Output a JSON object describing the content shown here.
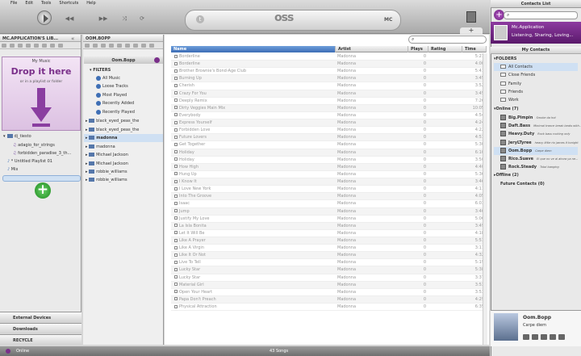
{
  "menu": [
    "File",
    "Edit",
    "Tools",
    "Shortcuts",
    "Help"
  ],
  "player": {
    "logo": "oss",
    "t_badge": "t",
    "mc_badge": "MC"
  },
  "library": {
    "header": "MC.APPLICATION'S LIB...",
    "my_music": "My Music",
    "drop_title": "Drop it here",
    "drop_sub": "or in a playlist or folder",
    "items": [
      {
        "label": "dj_tiesto",
        "type": "folder"
      },
      {
        "label": "adagio_for_strings",
        "type": "note"
      },
      {
        "label": "forbidden_paradise_3_th...",
        "type": "note"
      },
      {
        "label": "* Untitled Playlist 01",
        "type": "playlist"
      },
      {
        "label": "Mix",
        "type": "playlist"
      }
    ],
    "external": "External Devices",
    "downloads": "Downloads",
    "recycle": "RECYCLE"
  },
  "users": {
    "header": "OOM.BOPP",
    "current": "Oom.Bopp",
    "filters_label": "FILTERS",
    "filters": [
      "All Music",
      "Loose Tracks",
      "Most Played",
      "Recently Added",
      "Recently Played"
    ],
    "folders": [
      "black_eyed_peas_the",
      "black_eyed_peas_the",
      "madonna",
      "madonna",
      "Michael Jackson",
      "Michael Jackson",
      "robbie_williams",
      "robbie_williams"
    ]
  },
  "table": {
    "columns": [
      "Name",
      "Artist",
      "Plays",
      "Rating",
      "Time"
    ],
    "rows": [
      [
        "Borderline",
        "Madonna",
        "0",
        "",
        "5:21"
      ],
      [
        "Borderline",
        "Madonna",
        "0",
        "",
        "4:00"
      ],
      [
        "Brother Brownie's Bond-Age Club",
        "Madonna",
        "0",
        "",
        "5:41"
      ],
      [
        "Burning Up",
        "Madonna",
        "0",
        "",
        "3:45"
      ],
      [
        "Cherish",
        "Madonna",
        "0",
        "",
        "3:52"
      ],
      [
        "Crazy For You",
        "Madonna",
        "0",
        "",
        "3:45"
      ],
      [
        "Deeply Remix",
        "Madonna",
        "0",
        "",
        "7:26"
      ],
      [
        "Dirty Veggies Main Mix",
        "Madonna",
        "0",
        "",
        "10:05"
      ],
      [
        "Everybody",
        "Madonna",
        "0",
        "",
        "4:54"
      ],
      [
        "Express Yourself",
        "Madonna",
        "0",
        "",
        "4:24"
      ],
      [
        "Forbidden Love",
        "Madonna",
        "0",
        "",
        "4:22"
      ],
      [
        "Future Lovers",
        "Madonna",
        "0",
        "",
        "4:51"
      ],
      [
        "Get Together",
        "Madonna",
        "0",
        "",
        "5:30"
      ],
      [
        "Holiday",
        "Madonna",
        "0",
        "",
        "6:10"
      ],
      [
        "Holiday",
        "Madonna",
        "0",
        "",
        "3:50"
      ],
      [
        "How High",
        "Madonna",
        "0",
        "",
        "4:40"
      ],
      [
        "Hung Up",
        "Madonna",
        "0",
        "",
        "5:36"
      ],
      [
        "I Know It",
        "Madonna",
        "0",
        "",
        "3:46"
      ],
      [
        "I Love New York",
        "Madonna",
        "0",
        "",
        "4:11"
      ],
      [
        "Into The Groove",
        "Madonna",
        "0",
        "",
        "4:05"
      ],
      [
        "Isaac",
        "Madonna",
        "0",
        "",
        "6:03"
      ],
      [
        "Jump",
        "Madonna",
        "0",
        "",
        "3:46"
      ],
      [
        "Justify My Love",
        "Madonna",
        "0",
        "",
        "5:06"
      ],
      [
        "La Isla Bonita",
        "Madonna",
        "0",
        "",
        "3:49"
      ],
      [
        "Let It Will Be",
        "Madonna",
        "0",
        "",
        "4:18"
      ],
      [
        "Like A Prayer",
        "Madonna",
        "0",
        "",
        "5:51"
      ],
      [
        "Like A Virgin",
        "Madonna",
        "0",
        "",
        "3:11"
      ],
      [
        "Like It Or Not",
        "Madonna",
        "0",
        "",
        "4:32"
      ],
      [
        "Live To Tell",
        "Madonna",
        "0",
        "",
        "5:19"
      ],
      [
        "Lucky Star",
        "Madonna",
        "0",
        "",
        "5:38"
      ],
      [
        "Lucky Star",
        "Madonna",
        "0",
        "",
        "3:37"
      ],
      [
        "Material Girl",
        "Madonna",
        "0",
        "",
        "3:53"
      ],
      [
        "Open Your Heart",
        "Madonna",
        "0",
        "",
        "3:53"
      ],
      [
        "Papa Don't Preach",
        "Madonna",
        "0",
        "",
        "4:29"
      ],
      [
        "Physical Attraction",
        "Madonna",
        "0",
        "",
        "6:35"
      ]
    ]
  },
  "status": {
    "online": "Online",
    "songs": "43 Songs"
  },
  "contacts": {
    "header": "Contacts List",
    "profile_name": "Mc.Application",
    "profile_status": "Listening, Sharing, Loving...",
    "my_contacts": "My Contacts",
    "folders_label": "FOLDERS",
    "folders": [
      "All Contacts",
      "Close Friends",
      "Family",
      "Friends",
      "Work"
    ],
    "online_label": "Online (7)",
    "online": [
      {
        "name": "Big.Pimpin",
        "status": "Smoke da hot"
      },
      {
        "name": "Daft.Bass",
        "status": "Minimal trance break beats with..."
      },
      {
        "name": "Heavy.Duty",
        "status": "Rock bass rocking only"
      },
      {
        "name": "JeryLTyree",
        "status": "heavy little rio james it tonight"
      },
      {
        "name": "Oom.Bopp",
        "status": "Carpe diem"
      },
      {
        "name": "Rico.Suave",
        "status": "El que no ve al ahora ya ne..."
      },
      {
        "name": "Rock.Steady",
        "status": "Total banging"
      }
    ],
    "offline_label": "Offline (2)",
    "future_label": "Future Contacts (0)",
    "now_playing_name": "Oom.Bopp",
    "now_playing_status": "Carpe diem"
  }
}
